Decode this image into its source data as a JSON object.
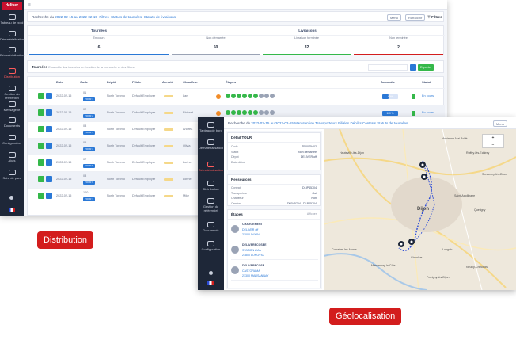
{
  "labels": {
    "distribution": "Distribution",
    "geolocalisation": "Géolocalisation"
  },
  "colors": {
    "brand_red": "#d31d1d",
    "sidebar": "#1e2738",
    "primary_blue": "#2a78d6",
    "success_green": "#35b84a",
    "warning_orange": "#f28c28"
  },
  "screen1": {
    "logo": "deliver",
    "topbar_title": "≡",
    "nav": [
      "Tableau de bord",
      "Dématérialisation",
      "Distribution",
      "Gestion du référentiel",
      "Messagerie",
      "Documents",
      "Configuration",
      "Ajuts",
      "Suivi de parc"
    ],
    "search": {
      "prefix": "Recherche du",
      "dates": "2022-02-15 au 2022-02-15",
      "filters": "Filtres",
      "status": "Statuts de tournées",
      "livraisons": "Statuts de livraisons"
    },
    "buttons": {
      "filter": "Filtres",
      "menu": "Menu",
      "refresh": "Rafraîchir"
    },
    "stats": {
      "tournees_title": "Tournées",
      "livraisons_title": "Livraisons",
      "cols": [
        {
          "label": "En cours",
          "value": "6"
        },
        {
          "label": "Non démarrée",
          "value": "50"
        },
        {
          "label": "Livraison terminée",
          "value": "32"
        },
        {
          "label": "Non terminée",
          "value": "2"
        }
      ]
    },
    "tour_header": {
      "title": "Tournées",
      "subtitle": "Ensemble des tournées en fonction de la recherche et des filtres",
      "export": "Exporter"
    },
    "table_headers": [
      "Date",
      "Code",
      "Dépôt",
      "Filiale",
      "Annoté",
      "Chauffeur",
      "Étapes",
      "Anomalie",
      "Statut"
    ],
    "rows": [
      {
        "date": "2022-02-15",
        "code": "01",
        "depot": "North Toronto",
        "filiale": "Default Employer",
        "chauffeur": "Lan",
        "pct": "40%",
        "pct_val": 0.4,
        "statut": "En cours",
        "pill": "TOUR 1"
      },
      {
        "date": "2022-02-15",
        "code": "02",
        "depot": "North Toronto",
        "filiale": "Default Employer",
        "chauffeur": "Richard",
        "pct": "100 %",
        "pct_val": 1.0,
        "statut": "En cours",
        "pill": "TOUR 2"
      },
      {
        "date": "2022-02-15",
        "code": "03",
        "depot": "North Toronto",
        "filiale": "Default Employer",
        "chauffeur": "Andrea",
        "pct": "",
        "pct_val": 0,
        "statut": "",
        "pill": "TOUR 3"
      },
      {
        "date": "2022-02-15",
        "code": "05",
        "depot": "North Toronto",
        "filiale": "Default Employer",
        "chauffeur": "Olivia",
        "pct": "",
        "pct_val": 0,
        "statut": "",
        "pill": "TOUR 4"
      },
      {
        "date": "2022-02-15",
        "code": "07",
        "depot": "North Toronto",
        "filiale": "Default Employer",
        "chauffeur": "Lorine",
        "pct": "",
        "pct_val": 0,
        "statut": "",
        "pill": "TOUR 5"
      },
      {
        "date": "2022-02-15",
        "code": "08",
        "depot": "North Toronto",
        "filiale": "Default Employer",
        "chauffeur": "Lorine",
        "pct": "",
        "pct_val": 0,
        "statut": "",
        "pill": "TOUR 6"
      },
      {
        "date": "2022-02-15",
        "code": "100",
        "depot": "North Toronto",
        "filiale": "Default Employer",
        "chauffeur": "Mike",
        "pct": "",
        "pct_val": 0,
        "statut": "",
        "pill": "TOUR 7"
      }
    ]
  },
  "screen2": {
    "nav": [
      "Tableau de bord",
      "Dématérialisation",
      "Distribution",
      "Gestion du référentiel",
      "Documents",
      "Configuration"
    ],
    "topbar": {
      "prefix": "Recherche du",
      "dates": "2022-02-15 au 2022-02-15",
      "items": [
        "Manutention",
        "Transporteurs",
        "Filiales",
        "Dépôts",
        "Contrats",
        "Statuts de tournées"
      ],
      "menu": "Menu"
    },
    "detail": {
      "title": "Détail TOUR",
      "fields": [
        {
          "k": "Code",
          "v": "TR0075402"
        },
        {
          "k": "Statut",
          "v": "Non démarrée"
        },
        {
          "k": "Dépôt",
          "v": "DELIVER off"
        },
        {
          "k": "Date début",
          "v": ""
        }
      ]
    },
    "resources": {
      "title": "Ressources",
      "fields": [
        {
          "k": "Contrat",
          "v": "DLIP45704"
        },
        {
          "k": "Transporteur",
          "v": "Oui"
        },
        {
          "k": "Chauffeur",
          "v": "Non"
        },
        {
          "k": "Camion",
          "v": "DLP45704 - DLP45704"
        }
      ]
    },
    "steps": {
      "title": "Étapes",
      "filter": "Afficher",
      "items": [
        {
          "name": "CHARGEMENT",
          "l1": "DELIVER off",
          "l2": "21000 DIJON"
        },
        {
          "name": "DELIVERECOSEE",
          "l1": "STATION AVIA",
          "l2": "21800 LONGVIC"
        },
        {
          "name": "DELIVERECOSE",
          "l1": "CASTORAMA",
          "l2": "21300 MARSANNAY"
        }
      ]
    },
    "map": {
      "cities": [
        "Ancienne-Mai-Brûlé",
        "Ruffey-lès-Echirey",
        "Hauteville-lès-Dijon",
        "Dijon",
        "Longvic",
        "Chenôve",
        "Saint-Apollinaire",
        "Quetigny",
        "Marsannay-la-Côte",
        "Neuilly-Crimolois",
        "Perrigny-lès-Dijon",
        "Corcelles-les-Monts",
        "Sennecey-lès-Dijon"
      ],
      "zoom_in": "+",
      "zoom_out": "−"
    }
  }
}
